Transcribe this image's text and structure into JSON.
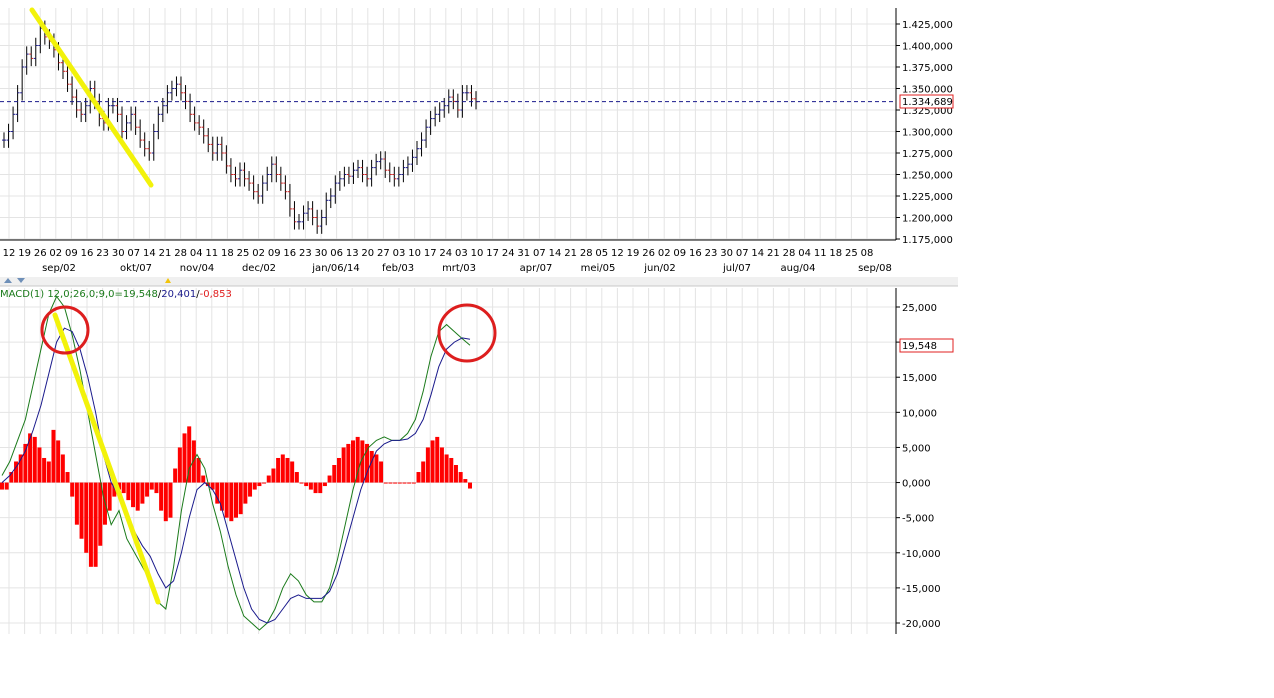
{
  "chart_data": [
    {
      "type": "bar",
      "subtype": "ohlc",
      "ylim": [
        1175000,
        1425000
      ],
      "yticks": [
        "1.425,000",
        "1.400,000",
        "1.375,000",
        "1.350,000",
        "1.325,000",
        "1.300,000",
        "1.275,000",
        "1.250,000",
        "1.225,000",
        "1.200,000",
        "1.175,000"
      ],
      "ytick_values": [
        1425000,
        1400000,
        1375000,
        1350000,
        1325000,
        1300000,
        1275000,
        1250000,
        1225000,
        1200000,
        1175000
      ],
      "last_value_label": "1.334,689",
      "last_value": 1334689,
      "day_ticks": [
        "12",
        "19",
        "26",
        "02",
        "09",
        "16",
        "23",
        "30",
        "07",
        "14",
        "21",
        "28",
        "04",
        "11",
        "18",
        "25",
        "02",
        "09",
        "16",
        "23",
        "30",
        "06",
        "13",
        "20",
        "27",
        "03",
        "10",
        "17",
        "24",
        "03",
        "10",
        "17",
        "24",
        "31",
        "07",
        "14",
        "21",
        "28",
        "05",
        "12",
        "19",
        "26",
        "02",
        "09",
        "16",
        "23",
        "30",
        "07",
        "14",
        "21",
        "28",
        "04",
        "11",
        "18",
        "25",
        "08"
      ],
      "month_ticks": [
        "sep/02",
        "okt/07",
        "nov/04",
        "dec/02",
        "jan/06/14",
        "feb/03",
        "mrt/03",
        "apr/07",
        "mei/05",
        "jun/02",
        "jul/07",
        "aug/04",
        "sep/08"
      ],
      "closes": [
        1290000,
        1300000,
        1320000,
        1345000,
        1375000,
        1390000,
        1385000,
        1400000,
        1420000,
        1410000,
        1405000,
        1395000,
        1380000,
        1370000,
        1355000,
        1340000,
        1325000,
        1320000,
        1330000,
        1350000,
        1335000,
        1315000,
        1310000,
        1330000,
        1330000,
        1320000,
        1300000,
        1310000,
        1320000,
        1305000,
        1290000,
        1280000,
        1275000,
        1300000,
        1320000,
        1330000,
        1345000,
        1350000,
        1355000,
        1345000,
        1335000,
        1320000,
        1310000,
        1305000,
        1295000,
        1285000,
        1275000,
        1285000,
        1275000,
        1260000,
        1250000,
        1245000,
        1255000,
        1245000,
        1240000,
        1230000,
        1225000,
        1240000,
        1250000,
        1262000,
        1250000,
        1240000,
        1230000,
        1210000,
        1195000,
        1195000,
        1205000,
        1210000,
        1200000,
        1190000,
        1200000,
        1220000,
        1225000,
        1240000,
        1245000,
        1250000,
        1248000,
        1255000,
        1258000,
        1250000,
        1245000,
        1258000,
        1265000,
        1268000,
        1255000,
        1250000,
        1245000,
        1250000,
        1258000,
        1262000,
        1270000,
        1280000,
        1290000,
        1305000,
        1315000,
        1320000,
        1325000,
        1330000,
        1340000,
        1335000,
        1325000,
        1345000,
        1345000,
        1338000,
        1334689
      ],
      "annotations": [
        "yellow trend line on price",
        "dashed horizontal line at last value"
      ]
    },
    {
      "type": "line",
      "title": "MACD(1) 12,0;26,0;9,0=19,548/20,401/-0,853",
      "title_parts": {
        "prefix": "MACD(1) 12,0;26,0;9,0=",
        "macd": "19,548",
        "sep1": "/",
        "signal": "20,401",
        "sep2": "/",
        "hist": "-0,853"
      },
      "ylim": [
        -22000,
        27000
      ],
      "yticks": [
        "25,000",
        "20,000",
        "15,000",
        "10,000",
        "5,000",
        "0,000",
        "-5,000",
        "-10,000",
        "-15,000",
        "-20,000"
      ],
      "ytick_values": [
        25000,
        20000,
        15000,
        10000,
        5000,
        0,
        -5000,
        -10000,
        -15000,
        -20000
      ],
      "last_value_label": "19,548",
      "series": [
        {
          "name": "MACD",
          "color": "#1a7a1a",
          "values": [
            1000,
            3000,
            6000,
            9000,
            14000,
            19000,
            24000,
            26500,
            25000,
            21000,
            16000,
            10000,
            4000,
            -2000,
            -6000,
            -4000,
            -8000,
            -10000,
            -12000,
            -14000,
            -17000,
            -18000,
            -12000,
            -4000,
            2000,
            4000,
            2000,
            -3000,
            -7000,
            -12000,
            -16000,
            -19000,
            -20000,
            -21000,
            -20000,
            -18000,
            -15000,
            -13000,
            -14000,
            -16000,
            -17000,
            -17000,
            -15000,
            -11000,
            -6000,
            -1000,
            3000,
            5000,
            6000,
            6500,
            6000,
            6000,
            7000,
            9000,
            13000,
            18000,
            21500,
            22500,
            21500,
            20500,
            19548
          ]
        },
        {
          "name": "Signal",
          "color": "#1a1a8c",
          "values": [
            0,
            1000,
            2500,
            4500,
            7500,
            11000,
            15500,
            20000,
            22000,
            21500,
            19000,
            15000,
            10000,
            4000,
            0,
            -2000,
            -5000,
            -7000,
            -9000,
            -10500,
            -13000,
            -15000,
            -14000,
            -10000,
            -5000,
            -1000,
            0,
            -1000,
            -3000,
            -7000,
            -11000,
            -15000,
            -18000,
            -19500,
            -20000,
            -19500,
            -18000,
            -16500,
            -16000,
            -16500,
            -16500,
            -16500,
            -15500,
            -13000,
            -9000,
            -5000,
            -1000,
            2000,
            4500,
            5500,
            6000,
            6000,
            6200,
            7000,
            9000,
            12500,
            16500,
            19000,
            20000,
            20600,
            20401
          ]
        },
        {
          "name": "Histogram",
          "color": "#ff0000",
          "kind": "bar",
          "values": [
            -1000,
            -1000,
            1500,
            3000,
            4000,
            5500,
            7000,
            6500,
            5000,
            3500,
            3000,
            7500,
            6000,
            4000,
            1500,
            -2000,
            -6000,
            -8000,
            -10000,
            -12000,
            -12000,
            -9000,
            -6000,
            -4000,
            -2000,
            -1000,
            -1500,
            -2500,
            -3500,
            -4000,
            -3000,
            -2000,
            -1000,
            -1500,
            -4000,
            -5500,
            -5000,
            2000,
            5000,
            7000,
            8000,
            6000,
            3500,
            1000,
            -500,
            -1000,
            -3000,
            -4000,
            -5000,
            -5500,
            -5000,
            -4500,
            -3000,
            -2000,
            -1000,
            -500,
            0,
            1000,
            2000,
            3500,
            4000,
            3500,
            3000,
            1500,
            0,
            -500,
            -1000,
            -1500,
            -1500,
            -500,
            1000,
            2500,
            3500,
            5000,
            5500,
            6000,
            6500,
            6000,
            5500,
            4500,
            4000,
            3000,
            0,
            0,
            0,
            0,
            0,
            0,
            0,
            1500,
            3000,
            5000,
            6000,
            6500,
            5000,
            4000,
            3500,
            2500,
            1500,
            500,
            -853
          ]
        }
      ],
      "annotations": [
        "yellow trend line",
        "red circle at top-left peak",
        "red circle at top-right peak"
      ]
    }
  ]
}
